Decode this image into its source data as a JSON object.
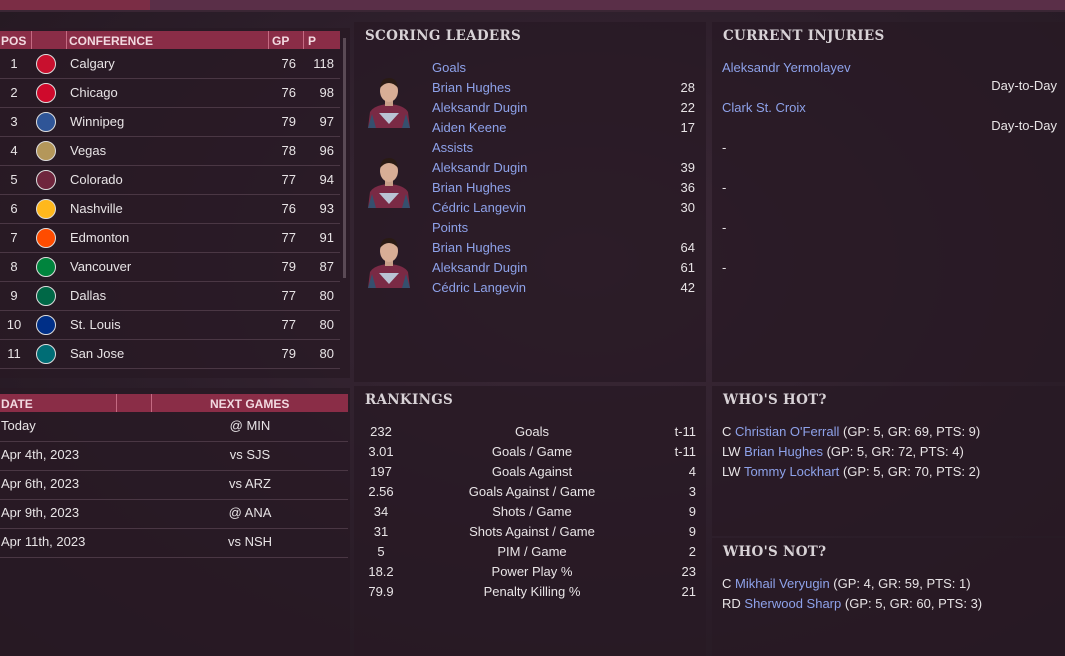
{
  "standings": {
    "columns": {
      "pos": "POS",
      "conference": "CONFERENCE",
      "gp": "GP",
      "p": "P"
    },
    "rows": [
      {
        "pos": "1",
        "team": "Calgary",
        "gp": "76",
        "p": "118",
        "color": "#c8102e"
      },
      {
        "pos": "2",
        "team": "Chicago",
        "gp": "76",
        "p": "98",
        "color": "#cf0a2c"
      },
      {
        "pos": "3",
        "team": "Winnipeg",
        "gp": "79",
        "p": "97",
        "color": "#2f5597"
      },
      {
        "pos": "4",
        "team": "Vegas",
        "gp": "78",
        "p": "96",
        "color": "#b4975a"
      },
      {
        "pos": "5",
        "team": "Colorado",
        "gp": "77",
        "p": "94",
        "color": "#6f263d"
      },
      {
        "pos": "6",
        "team": "Nashville",
        "gp": "76",
        "p": "93",
        "color": "#ffb81c"
      },
      {
        "pos": "7",
        "team": "Edmonton",
        "gp": "77",
        "p": "91",
        "color": "#ff4c00"
      },
      {
        "pos": "8",
        "team": "Vancouver",
        "gp": "79",
        "p": "87",
        "color": "#00843d"
      },
      {
        "pos": "9",
        "team": "Dallas",
        "gp": "77",
        "p": "80",
        "color": "#006847"
      },
      {
        "pos": "10",
        "team": "St. Louis",
        "gp": "77",
        "p": "80",
        "color": "#002f87"
      },
      {
        "pos": "11",
        "team": "San Jose",
        "gp": "79",
        "p": "80",
        "color": "#006d75"
      }
    ]
  },
  "games": {
    "columns": {
      "date": "DATE",
      "next": "NEXT GAMES"
    },
    "rows": [
      {
        "date": "Today",
        "opp": "@ MIN"
      },
      {
        "date": "Apr 4th, 2023",
        "opp": "vs SJS"
      },
      {
        "date": "Apr 6th, 2023",
        "opp": "vs ARZ"
      },
      {
        "date": "Apr 9th, 2023",
        "opp": "@ ANA"
      },
      {
        "date": "Apr 11th, 2023",
        "opp": "vs NSH"
      }
    ]
  },
  "scoring": {
    "title": "SCORING LEADERS",
    "groups": [
      {
        "label": "Goals",
        "players": [
          {
            "name": "Brian Hughes",
            "value": "28"
          },
          {
            "name": "Aleksandr Dugin",
            "value": "22"
          },
          {
            "name": "Aiden Keene",
            "value": "17"
          }
        ]
      },
      {
        "label": "Assists",
        "players": [
          {
            "name": "Aleksandr Dugin",
            "value": "39"
          },
          {
            "name": "Brian Hughes",
            "value": "36"
          },
          {
            "name": "Cédric Langevin",
            "value": "30"
          }
        ]
      },
      {
        "label": "Points",
        "players": [
          {
            "name": "Brian Hughes",
            "value": "64"
          },
          {
            "name": "Aleksandr Dugin",
            "value": "61"
          },
          {
            "name": "Cédric Langevin",
            "value": "42"
          }
        ]
      }
    ]
  },
  "injuries": {
    "title": "CURRENT INJURIES",
    "items": [
      {
        "name": "Aleksandr Yermolayev",
        "status": "Day-to-Day"
      },
      {
        "name": "Clark St. Croix",
        "status": "Day-to-Day"
      }
    ],
    "placeholders": [
      "-",
      "-",
      "-",
      "-"
    ]
  },
  "rankings": {
    "title": "RANKINGS",
    "rows": [
      {
        "value": "232",
        "stat": "Goals",
        "rank": "t-11"
      },
      {
        "value": "3.01",
        "stat": "Goals / Game",
        "rank": "t-11"
      },
      {
        "value": "197",
        "stat": "Goals Against",
        "rank": "4"
      },
      {
        "value": "2.56",
        "stat": "Goals Against / Game",
        "rank": "3"
      },
      {
        "value": "34",
        "stat": "Shots / Game",
        "rank": "9"
      },
      {
        "value": "31",
        "stat": "Shots Against / Game",
        "rank": "9"
      },
      {
        "value": "5",
        "stat": "PIM / Game",
        "rank": "2"
      },
      {
        "value": "18.2",
        "stat": "Power Play %",
        "rank": "23"
      },
      {
        "value": "79.9",
        "stat": "Penalty Killing %",
        "rank": "21"
      }
    ]
  },
  "hot": {
    "title": "WHO'S HOT?",
    "rows": [
      {
        "pos": "C",
        "name": "Christian O'Ferrall",
        "stats": "(GP: 5, GR: 69, PTS: 9)"
      },
      {
        "pos": "LW",
        "name": "Brian Hughes",
        "stats": "(GP: 5, GR: 72, PTS: 4)"
      },
      {
        "pos": "LW",
        "name": "Tommy Lockhart",
        "stats": "(GP: 5, GR: 70, PTS: 2)"
      }
    ]
  },
  "cold": {
    "title": "WHO'S NOT?",
    "rows": [
      {
        "pos": "C",
        "name": "Mikhail Veryugin",
        "stats": "(GP: 4, GR: 59, PTS: 1)"
      },
      {
        "pos": "RD",
        "name": "Sherwood Sharp",
        "stats": "(GP: 5, GR: 60, PTS: 3)"
      }
    ]
  }
}
